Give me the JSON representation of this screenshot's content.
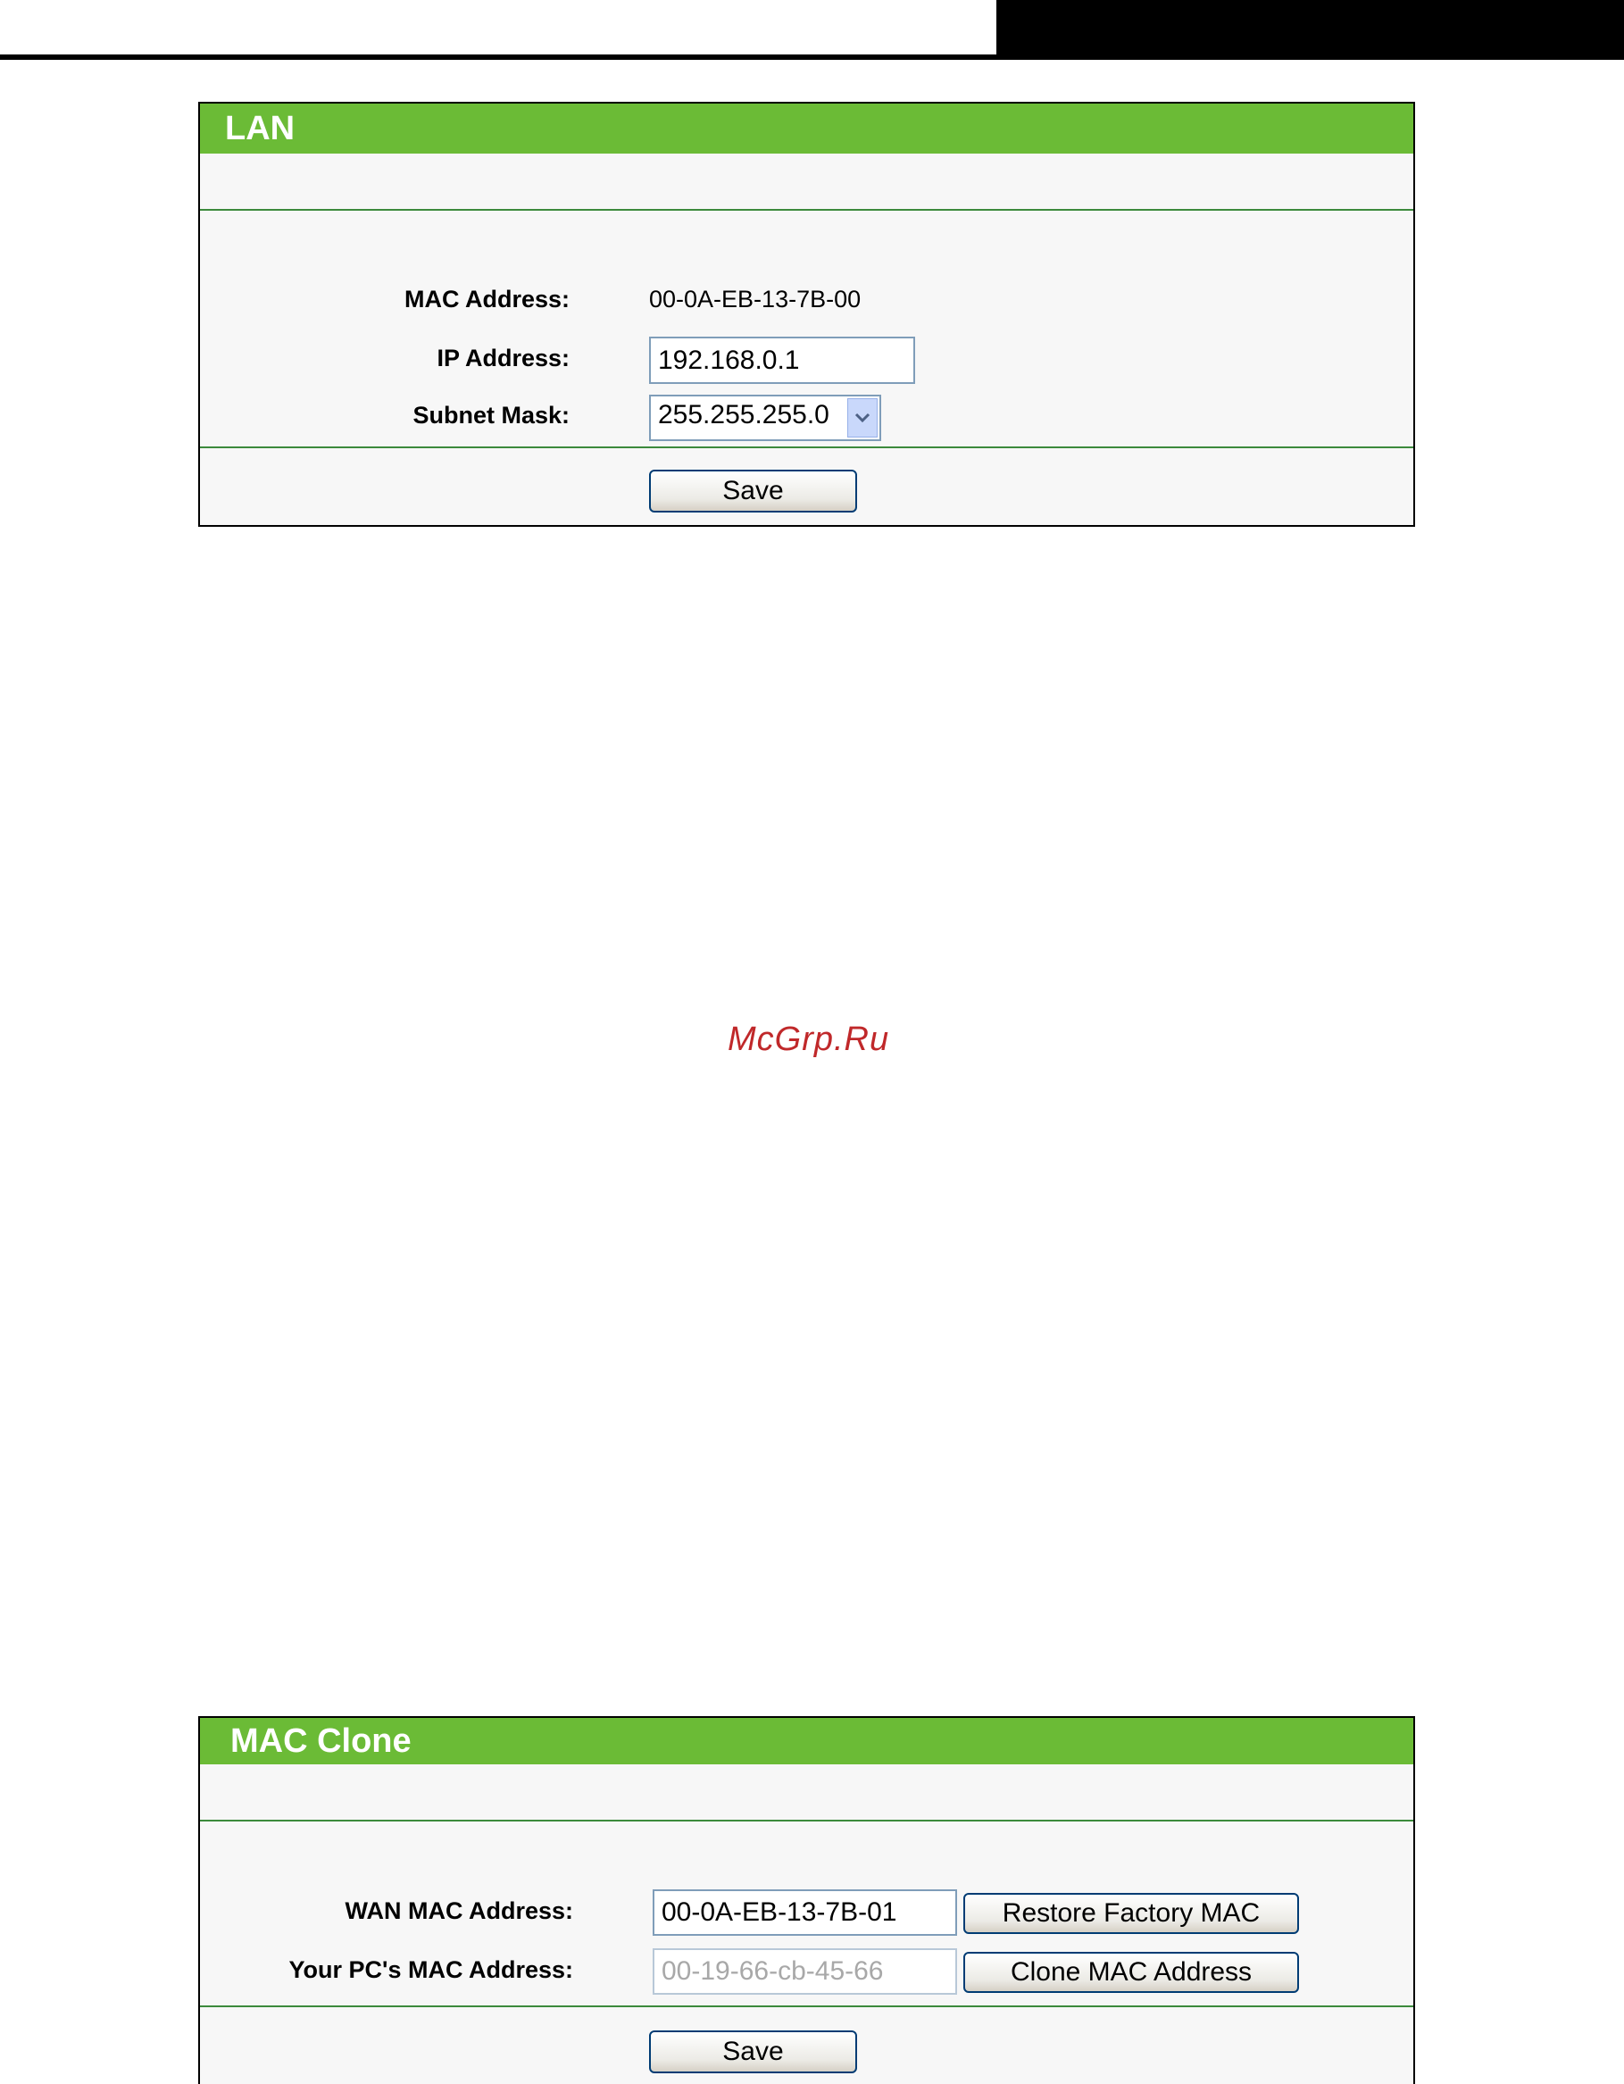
{
  "lan": {
    "title": "LAN",
    "mac_label": "MAC Address:",
    "mac_value": "00-0A-EB-13-7B-00",
    "ip_label": "IP Address:",
    "ip_value": "192.168.0.1",
    "subnet_label": "Subnet Mask:",
    "subnet_value": "255.255.255.0",
    "save_label": "Save"
  },
  "watermark": "McGrp.Ru",
  "mac_clone": {
    "title": "MAC Clone",
    "wan_label": "WAN MAC Address:",
    "wan_value": "00-0A-EB-13-7B-01",
    "restore_label": "Restore Factory MAC",
    "pc_label": "Your PC's MAC Address:",
    "pc_value": "00-19-66-cb-45-66",
    "clone_label": "Clone MAC Address",
    "save_label": "Save"
  },
  "colors": {
    "header_green": "#6bbb36",
    "divider_green": "#3c8a3c",
    "watermark_red": "#c0282a"
  }
}
